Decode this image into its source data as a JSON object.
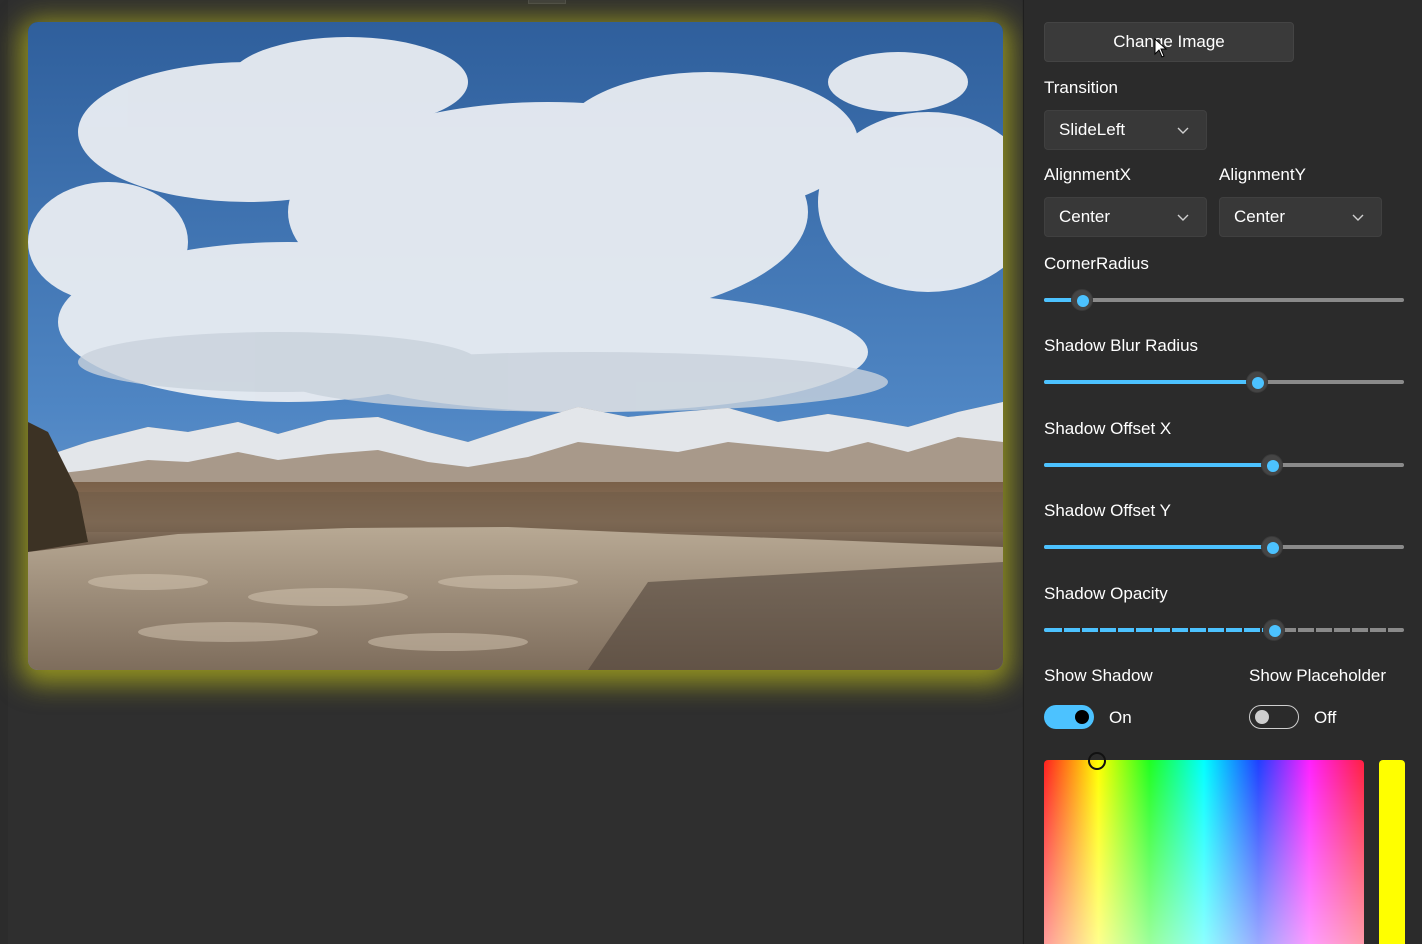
{
  "panel": {
    "change_image_label": "Change Image",
    "transition": {
      "label": "Transition",
      "value": "SlideLeft"
    },
    "alignment_x": {
      "label": "AlignmentX",
      "value": "Center"
    },
    "alignment_y": {
      "label": "AlignmentY",
      "value": "Center"
    },
    "corner_radius": {
      "label": "CornerRadius",
      "fraction": 0.105
    },
    "shadow_blur_radius": {
      "label": "Shadow Blur Radius",
      "fraction": 0.592
    },
    "shadow_offset_x": {
      "label": "Shadow Offset X",
      "fraction": 0.633
    },
    "shadow_offset_y": {
      "label": "Shadow Offset Y",
      "fraction": 0.633
    },
    "shadow_opacity": {
      "label": "Shadow Opacity",
      "fraction": 0.638
    },
    "show_shadow": {
      "label": "Show Shadow",
      "state": "On"
    },
    "show_placeholder": {
      "label": "Show Placeholder",
      "state": "Off"
    }
  },
  "colors": {
    "accent": "#4cc2ff",
    "shadow_color": "#ffff00",
    "shadow_glow": "#e2e214"
  },
  "icons": {
    "dropdown": "chevron-down-icon",
    "cursor": "mouse-pointer-icon"
  }
}
